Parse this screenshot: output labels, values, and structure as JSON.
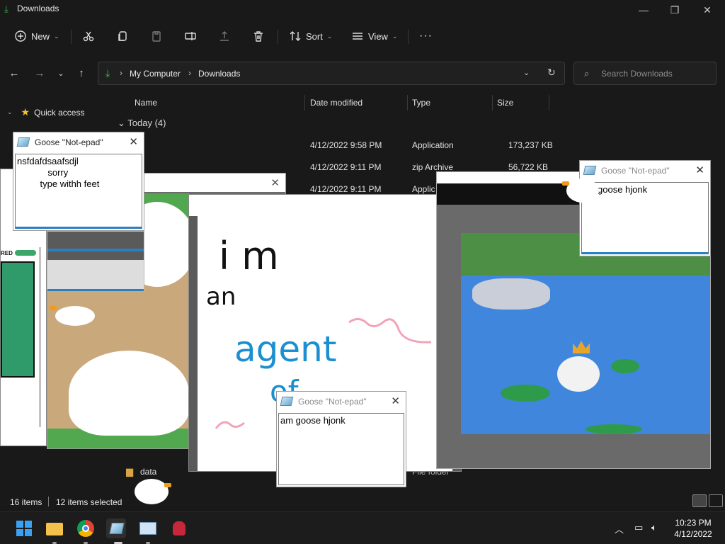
{
  "explorer": {
    "title": "Downloads",
    "commands": {
      "new_label": "New",
      "sort_label": "Sort",
      "view_label": "View",
      "more_label": "···"
    },
    "address": {
      "crumbs": [
        "My Computer",
        "Downloads"
      ]
    },
    "search": {
      "placeholder": "Search Downloads"
    },
    "sidebar": {
      "quick_access": "Quick access"
    },
    "columns": {
      "name": "Name",
      "date": "Date modified",
      "type": "Type",
      "size": "Size"
    },
    "group": {
      "label": "Today (4)"
    },
    "rows": [
      {
        "date": "4/12/2022 9:58 PM",
        "type": "Application",
        "size": "173,237 KB"
      },
      {
        "date": "4/12/2022 9:11 PM",
        "type": "zip Archive",
        "size": "56,722 KB"
      },
      {
        "date": "4/12/2022 9:11 PM",
        "type": "Applic"
      }
    ],
    "bottom_rows": [
      {
        "name": "data",
        "type": "File folder"
      }
    ],
    "status": {
      "items": "16 items",
      "selected": "12 items selected"
    }
  },
  "goose": {
    "notepad_title": "Goose \"Not-epad\"",
    "notes": [
      {
        "text": "nsfdafdsaafsdjl\n            sorry\n         type withh feet"
      },
      {
        "text": "goose hjonk"
      },
      {
        "text": "am goose hjonk"
      }
    ],
    "drawing_words": [
      "i m",
      "an",
      "agent",
      "of"
    ],
    "meme_text": "RED"
  },
  "taskbar": {
    "time": "10:23 PM",
    "date": "4/12/2022"
  },
  "colors": {
    "accent_green": "#3fb950",
    "star_yellow": "#f2c12e",
    "explorer_bg": "#191919"
  }
}
